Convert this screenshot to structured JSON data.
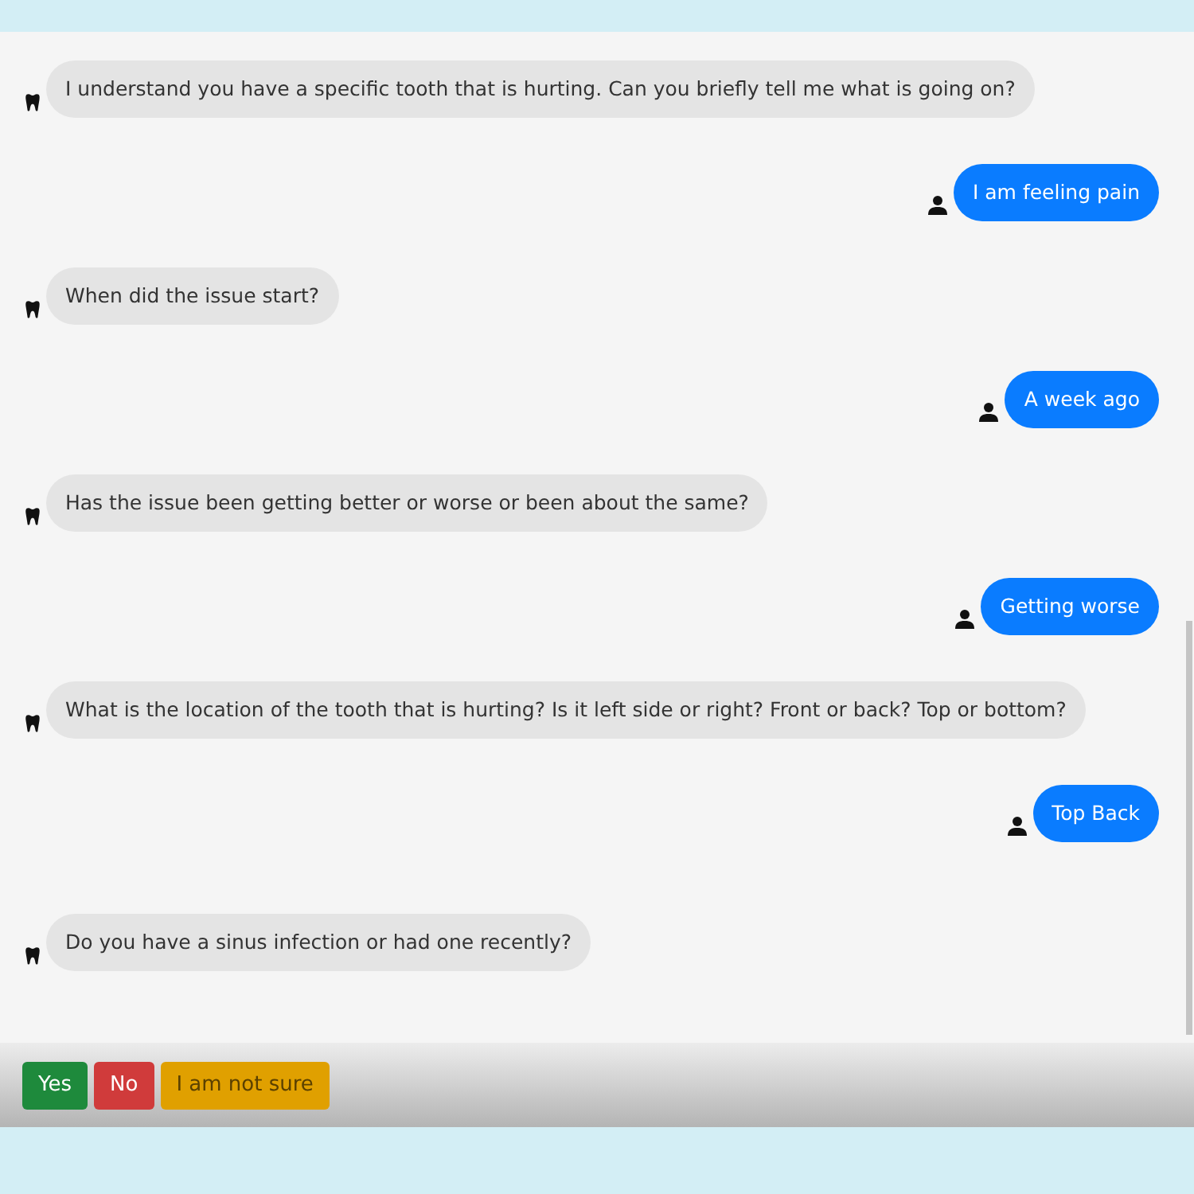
{
  "messages": [
    {
      "kind": "bot",
      "text": "I understand you have a specific tooth that is hurting. Can you briefly tell me what is going on?"
    },
    {
      "kind": "user",
      "text": "I am feeling pain"
    },
    {
      "kind": "bot",
      "text": "When did the issue start?"
    },
    {
      "kind": "user",
      "text": "A week ago"
    },
    {
      "kind": "bot",
      "text": "Has the issue been getting better or worse or been about the same?"
    },
    {
      "kind": "user",
      "text": "Getting worse"
    },
    {
      "kind": "bot",
      "text": "What is the location of the tooth that is hurting? Is it left side or right? Front or back? Top or bottom?"
    },
    {
      "kind": "user",
      "text": "Top Back"
    },
    {
      "kind": "bot",
      "text": "Do you have a sinus infection or had one recently?"
    }
  ],
  "answers": [
    {
      "label": "Yes",
      "color": "#1e8a3c"
    },
    {
      "label": "No",
      "color": "#d03b3b"
    },
    {
      "label": "I am not sure",
      "color": "#e0a000"
    }
  ]
}
